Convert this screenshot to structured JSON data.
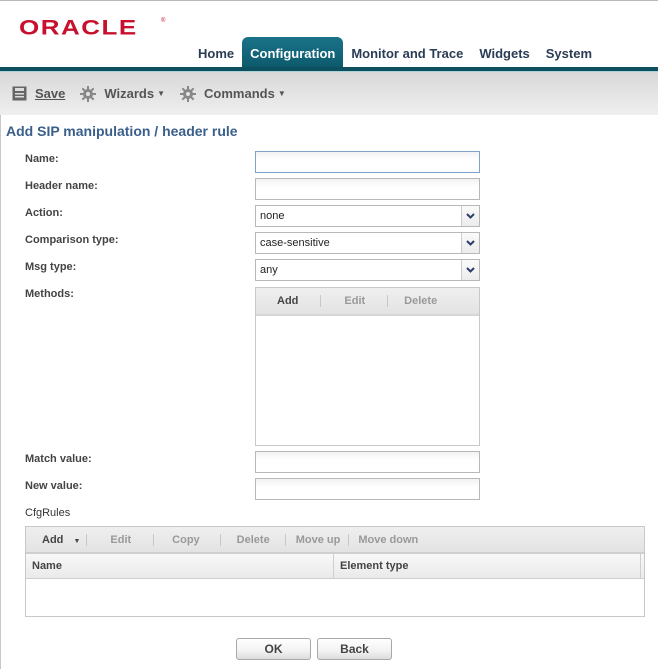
{
  "brand": {
    "logo_text": "ORACLE",
    "registered": "®",
    "brand_color": "#c8102e"
  },
  "nav": {
    "tabs": [
      {
        "label": "Home",
        "active": false
      },
      {
        "label": "Configuration",
        "active": true
      },
      {
        "label": "Monitor and Trace",
        "active": false
      },
      {
        "label": "Widgets",
        "active": false
      },
      {
        "label": "System",
        "active": false
      }
    ],
    "accent_color": "#0d5a6d"
  },
  "toolbar": {
    "save": {
      "label": "Save",
      "icon": "save-icon"
    },
    "wizards": {
      "label": "Wizards",
      "icon": "gear-icon"
    },
    "commands": {
      "label": "Commands",
      "icon": "gear-icon"
    }
  },
  "page": {
    "title": "Add SIP manipulation / header rule"
  },
  "form": {
    "name": {
      "label": "Name:",
      "value": ""
    },
    "header_name": {
      "label": "Header name:",
      "value": ""
    },
    "action": {
      "label": "Action:",
      "value": "none"
    },
    "comparison_type": {
      "label": "Comparison type:",
      "value": "case-sensitive"
    },
    "msg_type": {
      "label": "Msg type:",
      "value": "any"
    },
    "methods": {
      "label": "Methods:",
      "toolbar": {
        "add": "Add",
        "edit": "Edit",
        "delete": "Delete"
      },
      "items": []
    },
    "match_value": {
      "label": "Match value:",
      "value": ""
    },
    "new_value": {
      "label": "New value:",
      "value": ""
    }
  },
  "cfg_rules": {
    "label": "CfgRules",
    "toolbar": {
      "add": "Add",
      "edit": "Edit",
      "copy": "Copy",
      "delete": "Delete",
      "move_up": "Move up",
      "move_down": "Move down"
    },
    "columns": [
      "Name",
      "Element type"
    ],
    "rows": []
  },
  "actions": {
    "ok": "OK",
    "back": "Back"
  }
}
